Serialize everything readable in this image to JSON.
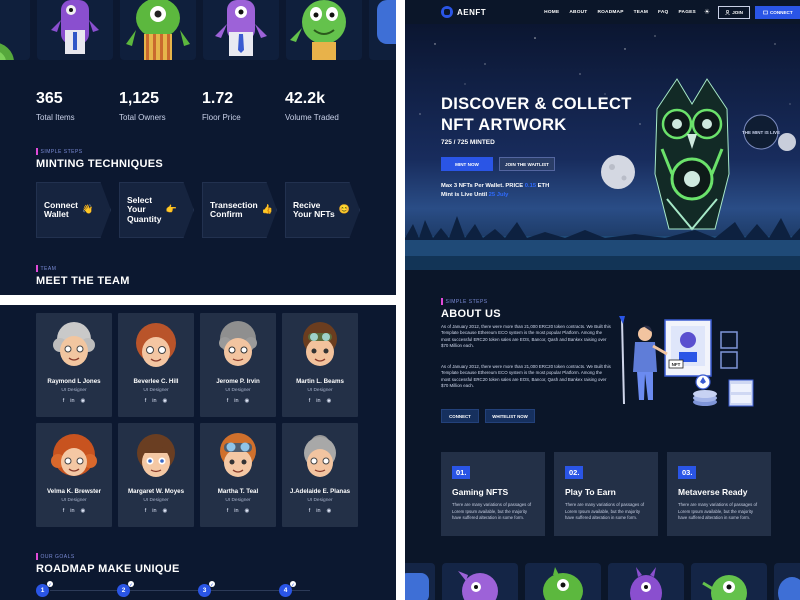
{
  "stats": [
    {
      "value": "365",
      "label": "Total Items"
    },
    {
      "value": "1,125",
      "label": "Total Owners"
    },
    {
      "value": "1.72",
      "label": "Floor Price"
    },
    {
      "value": "42.2k",
      "label": "Volume Traded"
    }
  ],
  "minting": {
    "eyebrow": "SIMPLE STEPS",
    "title": "MINTING TECHNIQUES",
    "steps": [
      {
        "line1": "Connect",
        "line2": "Wallet",
        "line3": "",
        "emoji": "👋"
      },
      {
        "line1": "Select",
        "line2": "Your",
        "line3": "Quantity",
        "emoji": "👉"
      },
      {
        "line1": "Transection",
        "line2": "Confirm",
        "line3": "",
        "emoji": "👍"
      },
      {
        "line1": "Recive",
        "line2": "Your NFTs",
        "line3": "",
        "emoji": "😊"
      }
    ]
  },
  "team": {
    "eyebrow": "TEAM",
    "title": "MEET THE TEAM",
    "members": [
      {
        "name": "Raymond L Jones",
        "role": "UI Designer"
      },
      {
        "name": "Beverlee C. Hill",
        "role": "UI Designer"
      },
      {
        "name": "Jerome P. Irvin",
        "role": "UI Designer"
      },
      {
        "name": "Martin L. Beams",
        "role": "UI Designer"
      },
      {
        "name": "Velma K. Brewster",
        "role": "UI Designer"
      },
      {
        "name": "Margaret W. Moyes",
        "role": "UI Designer"
      },
      {
        "name": "Martha T. Teal",
        "role": "UI Designer"
      },
      {
        "name": "J.Adelaide E. Planas",
        "role": "UI Designer"
      }
    ],
    "social_icons": [
      "f",
      "in",
      "◉"
    ]
  },
  "roadmap": {
    "eyebrow": "OUR GOALS",
    "title": "ROADMAP MAKE UNIQUE",
    "steps": [
      "1",
      "2",
      "3",
      "4"
    ]
  },
  "nav": {
    "brand": "AENFT",
    "items": [
      "HOME",
      "ABOUT",
      "ROADMAP",
      "TEAM",
      "FAQ",
      "PAGES"
    ],
    "theme_icon": "☀",
    "join": "JOIN",
    "connect": "CONNECT"
  },
  "hero": {
    "title_line1": "DISCOVER & COLLECT",
    "title_line2": "NFT ARTWORK",
    "minted": "725 / 725 MINTED",
    "mint_btn": "MINT NOW",
    "whitelist_btn": "JOIN THE WAITLIST",
    "info1_pre": "Max 3 NFTs Per Wallet. PRICE ",
    "info1_hl": "0.15",
    "info1_post": " ETH",
    "info2_pre": "Mint is Live Until ",
    "info2_hl": "25 July",
    "badge": "THE MINT IS LIVE"
  },
  "about": {
    "eyebrow": "SIMPLE STEPS",
    "title": "ABOUT US",
    "p1": "As of January 2012, there were more than 21,000 ERC20 token contracts. We Built this Template because Ethereum ECO system is the most popular Platform. Among the most successful ERC20 token sales are EOS, Bancor, Qash and Bankex raising over $70 Million each.",
    "p2": "As of January 2012, there were more than 21,000 ERC20 token contracts. We Built this Template because Ethereum ECO system is the most popular Platform. Among the most successful ERC20 token sales are EOS, Bancor, Qash and Bankex raising over $70 Million each.",
    "connect_btn": "CONNECT",
    "whitelist_btn": "WHITELIST NOW",
    "nft_tag": "NFT"
  },
  "features": [
    {
      "num": "01.",
      "title": "Gaming NFTS",
      "desc": "There are many variations of passages of Lorem Ipsum available, but the majority have suffered alteration in some form."
    },
    {
      "num": "02.",
      "title": "Play To Earn",
      "desc": "There are many variations of passages of Lorem Ipsum available, but the majority have suffered alteration in some form."
    },
    {
      "num": "03.",
      "title": "Metaverse Ready",
      "desc": "There are many variations of passages of Lorem Ipsum available, but the majority have suffered alteration in some form."
    }
  ],
  "colors": {
    "bg": "#0c1830",
    "card": "#233047",
    "accent": "#2a55e6",
    "eyebrow": "#7b8bd6",
    "pink_bar": "#e04ad8"
  }
}
